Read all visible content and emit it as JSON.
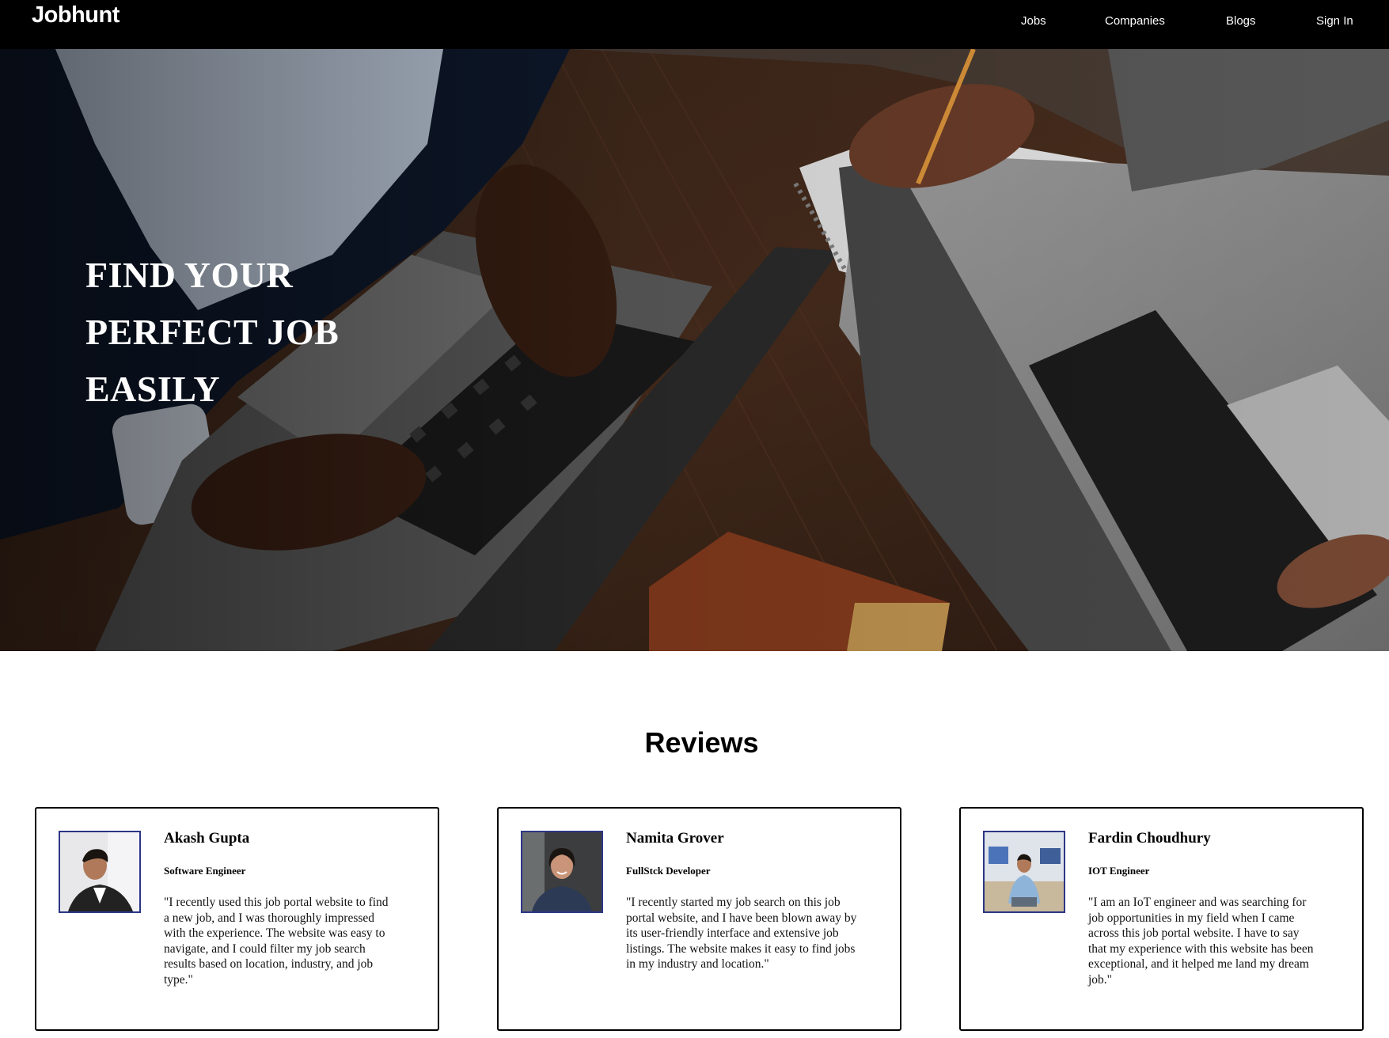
{
  "nav": {
    "brand": "Jobhunt",
    "links": [
      "Jobs",
      "Companies",
      "Blogs",
      "Sign In"
    ]
  },
  "hero": {
    "title_lines": [
      "FIND YOUR",
      "PERFECT JOB",
      "EASILY"
    ]
  },
  "reviews": {
    "heading": "Reviews",
    "items": [
      {
        "name": "Akash Gupta",
        "role": "Software Engineer",
        "quote": "\"I recently used this job portal website to find a new job, and I was thoroughly impressed with the experience. The website was easy to navigate, and I could filter my job search results based on location, industry, and job type.\""
      },
      {
        "name": "Namita Grover",
        "role": "FullStck Developer",
        "quote": "\"I recently started my job search on this job portal website, and I have been blown away by its user-friendly interface and extensive job listings. The website makes it easy to find jobs in my industry and location.\""
      },
      {
        "name": "Fardin Choudhury",
        "role": "IOT Engineer",
        "quote": "\"I am an IoT engineer and was searching for job opportunities in my field when I came across this job portal website. I have to say that my experience with this website has been exceptional, and it helped me land my dream job.\""
      }
    ]
  }
}
